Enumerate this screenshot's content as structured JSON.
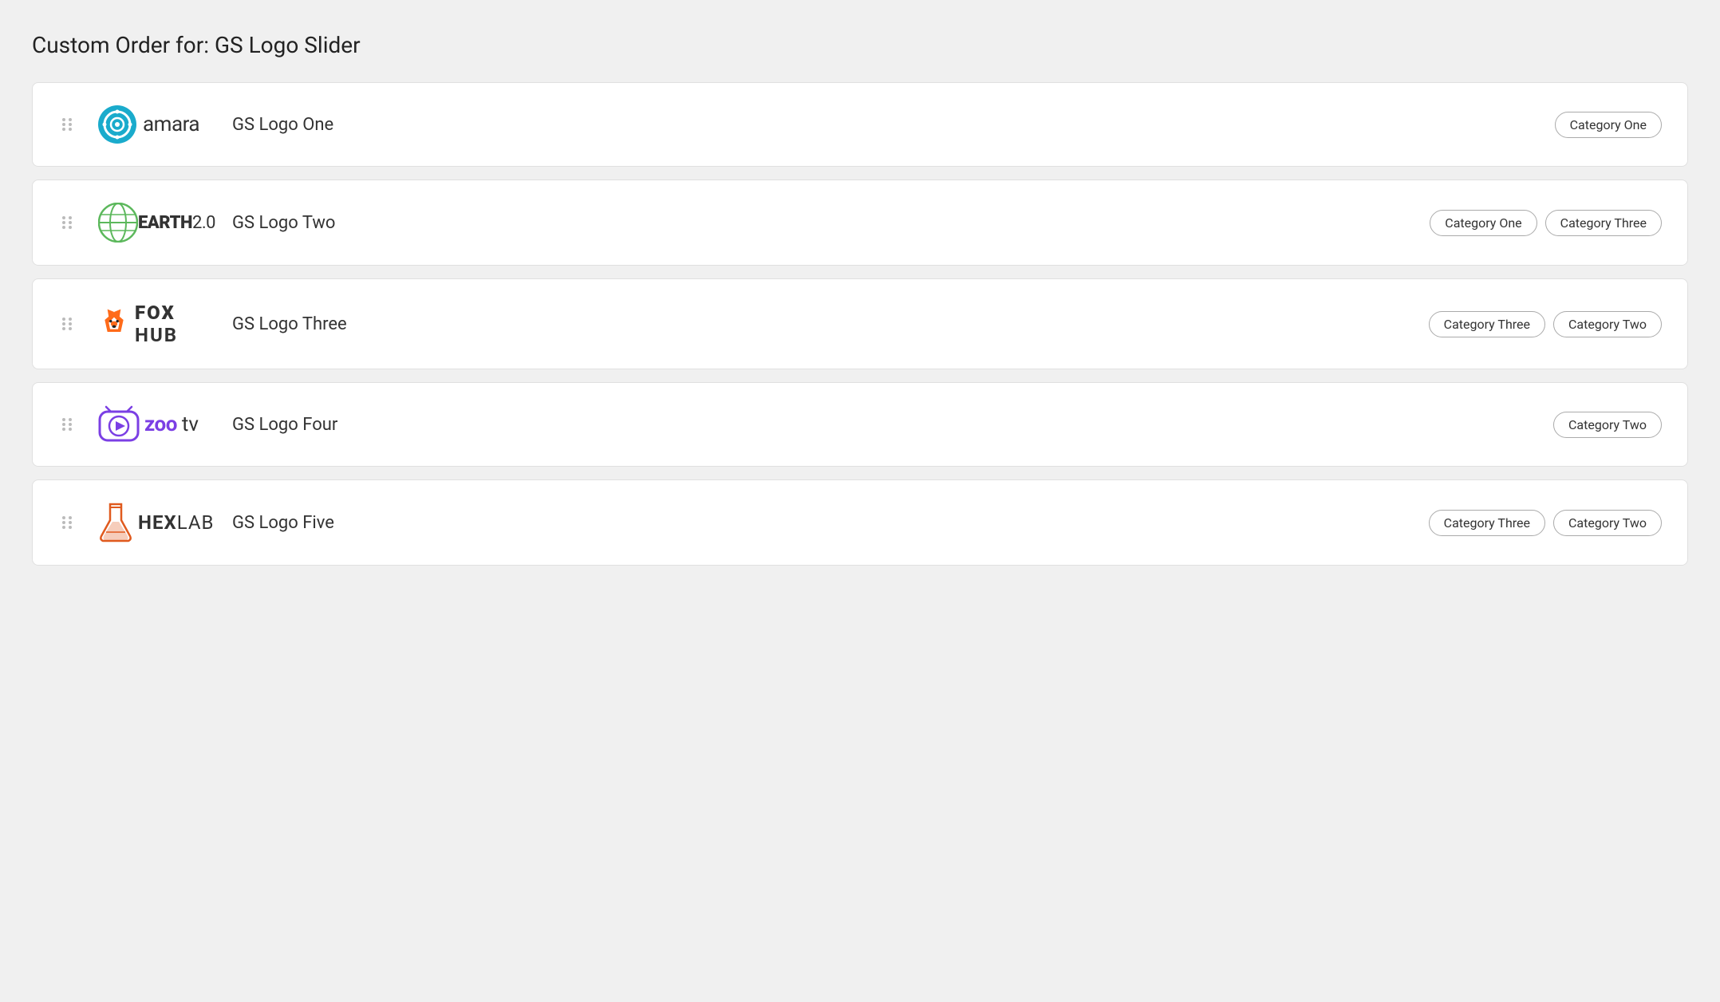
{
  "page": {
    "title": "Custom Order for: GS Logo Slider"
  },
  "items": [
    {
      "id": "gs-logo-one",
      "name": "GS Logo One",
      "logo": "amara",
      "categories": [
        "Category One"
      ]
    },
    {
      "id": "gs-logo-two",
      "name": "GS Logo Two",
      "logo": "earth",
      "categories": [
        "Category One",
        "Category Three"
      ]
    },
    {
      "id": "gs-logo-three",
      "name": "GS Logo Three",
      "logo": "foxhub",
      "categories": [
        "Category Three",
        "Category Two"
      ]
    },
    {
      "id": "gs-logo-four",
      "name": "GS Logo Four",
      "logo": "zootv",
      "categories": [
        "Category Two"
      ]
    },
    {
      "id": "gs-logo-five",
      "name": "GS Logo Five",
      "logo": "hexlab",
      "categories": [
        "Category Three",
        "Category Two"
      ]
    }
  ]
}
